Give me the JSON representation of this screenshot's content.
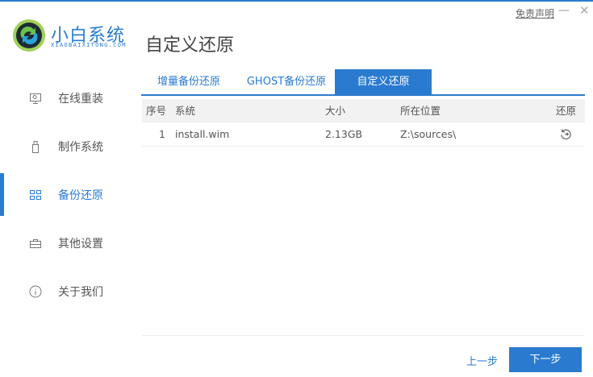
{
  "app": {
    "brand": "小白系统",
    "brand_sub": "XIAOBAIXITONG.COM",
    "disclaimer": "免责声明",
    "minimize": "—",
    "close": "✕",
    "accent": "#2a7bd0"
  },
  "page": {
    "title": "自定义还原"
  },
  "sidebar": {
    "items": [
      {
        "label": "在线重装",
        "icon": "monitor-icon"
      },
      {
        "label": "制作系统",
        "icon": "usb-icon"
      },
      {
        "label": "备份还原",
        "icon": "grid-icon",
        "active": true
      },
      {
        "label": "其他设置",
        "icon": "briefcase-icon"
      },
      {
        "label": "关于我们",
        "icon": "info-icon"
      }
    ]
  },
  "tabs": [
    {
      "label": "增量备份还原"
    },
    {
      "label": "GHOST备份还原"
    },
    {
      "label": "自定义还原",
      "active": true
    }
  ],
  "table": {
    "headers": [
      "序号",
      "系统",
      "大小",
      "所在位置",
      "还原"
    ],
    "rows": [
      {
        "index": "1",
        "system": "install.wim",
        "size": "2.13GB",
        "location": "Z:\\sources\\",
        "action_icon": "restore-icon"
      }
    ]
  },
  "footer": {
    "prev": "上一步",
    "next": "下一步"
  }
}
